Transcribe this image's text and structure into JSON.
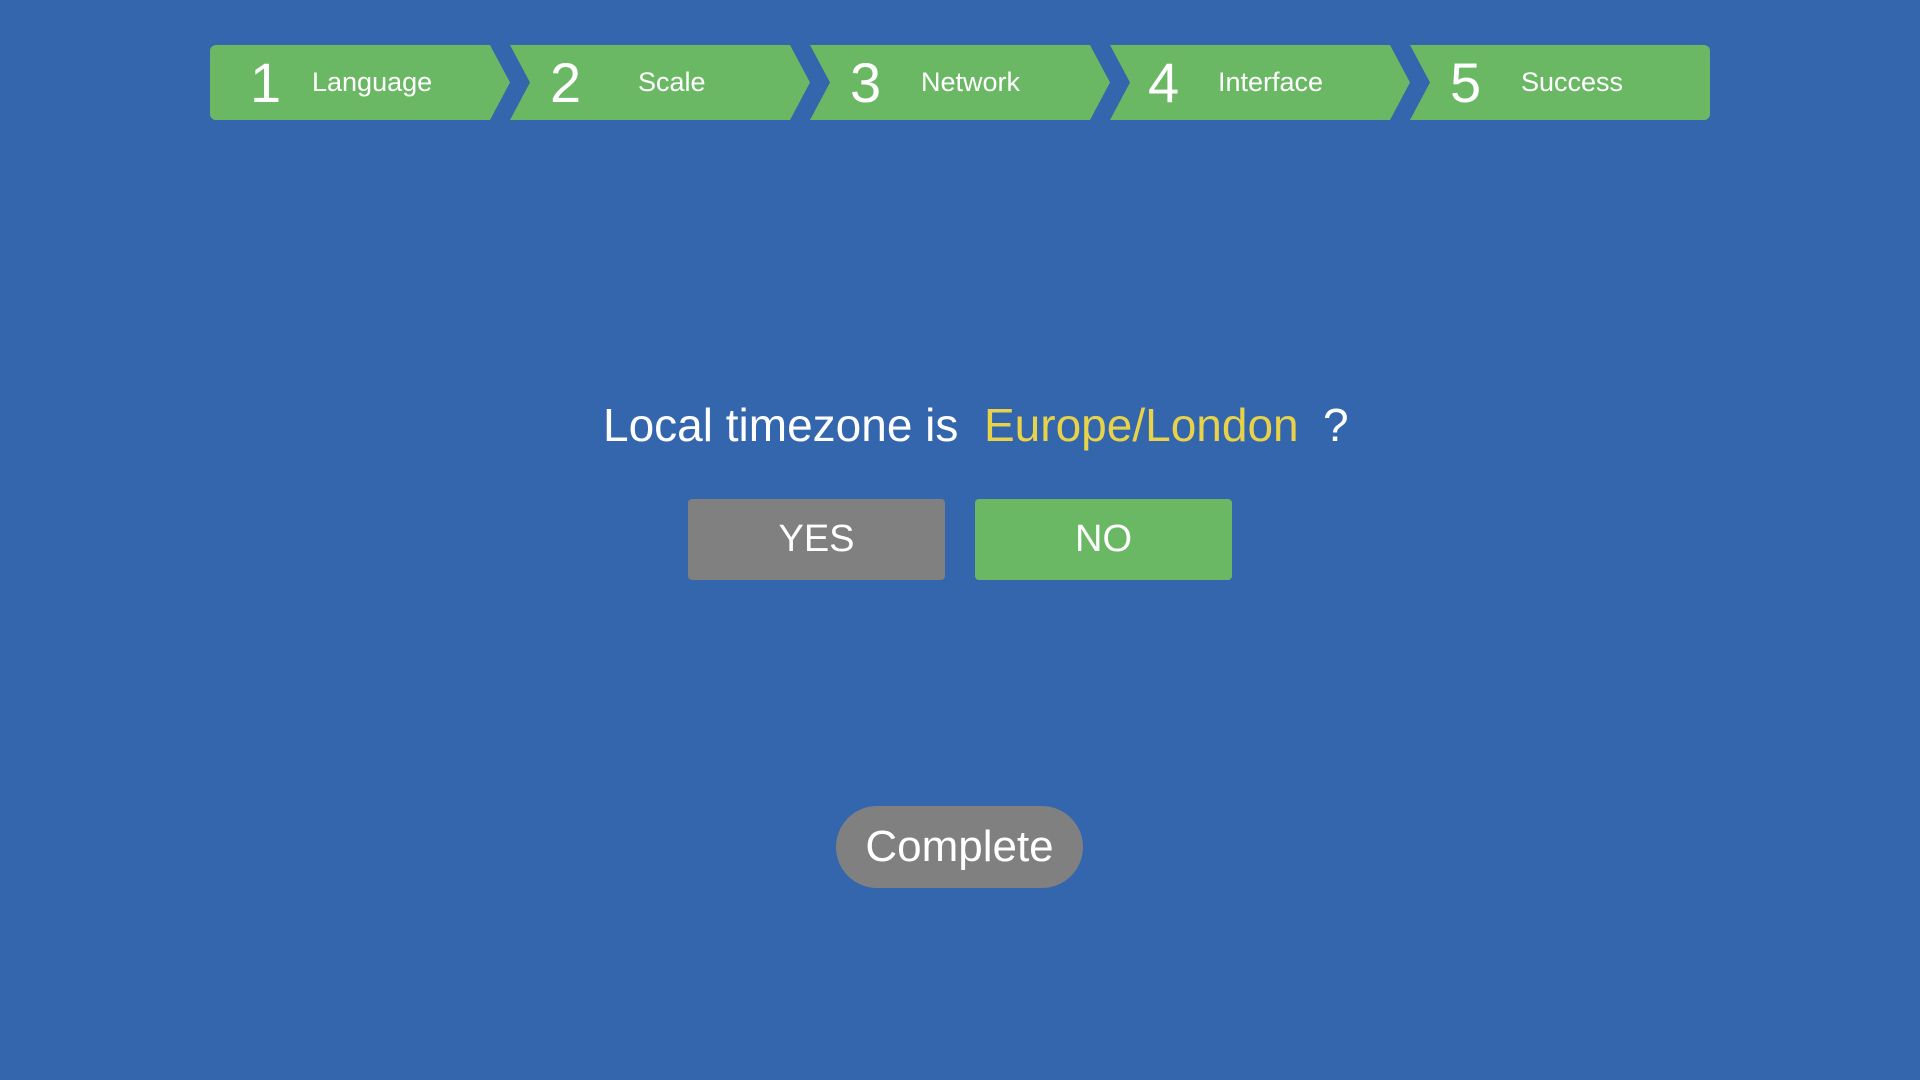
{
  "colors": {
    "background": "#3366ad",
    "accent_green": "#6ab864",
    "neutral_gray": "#808080",
    "highlight_yellow": "#e8d24a"
  },
  "stepper": {
    "steps": [
      {
        "number": "1",
        "label": "Language"
      },
      {
        "number": "2",
        "label": "Scale"
      },
      {
        "number": "3",
        "label": "Network"
      },
      {
        "number": "4",
        "label": "Interface"
      },
      {
        "number": "5",
        "label": "Success"
      }
    ]
  },
  "question": {
    "prefix": "Local timezone is",
    "timezone": "Europe/London",
    "suffix": "?"
  },
  "buttons": {
    "yes": "YES",
    "no": "NO",
    "complete": "Complete"
  }
}
